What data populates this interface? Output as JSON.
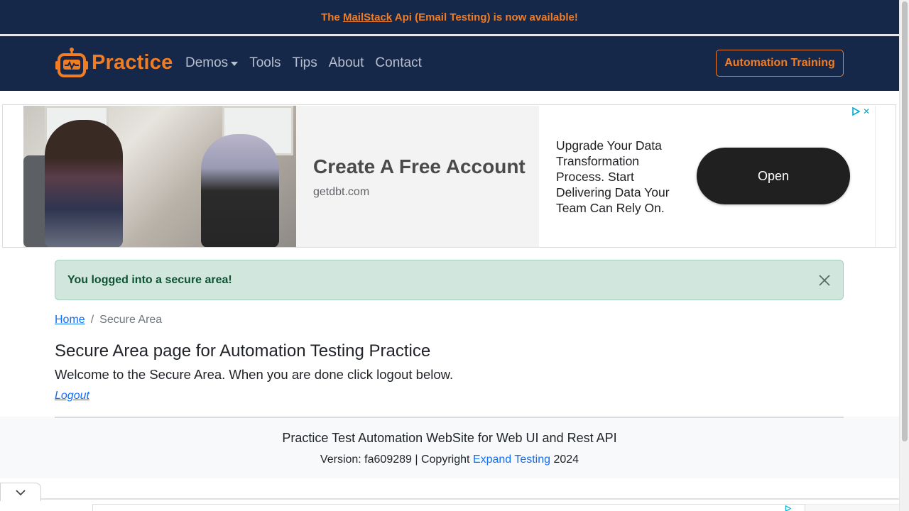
{
  "announcement": {
    "prefix": "The ",
    "link": "MailStack",
    "suffix": " Api (Email Testing) is now available!"
  },
  "nav": {
    "brand": "Practice",
    "links": [
      "Demos",
      "Tools",
      "Tips",
      "About",
      "Contact"
    ],
    "cta": "Automation Training"
  },
  "ad": {
    "headline": "Create A Free Account",
    "domain": "getdbt.com",
    "body": "Upgrade Your Data Transformation Process. Start Delivering Data Your Team Can Rely On.",
    "button": "Open",
    "choices_icon": "adchoices-icon",
    "close_label": "✕"
  },
  "alert": {
    "message": "You logged into a secure area!"
  },
  "breadcrumb": {
    "home": "Home",
    "separator": "/",
    "current": "Secure Area"
  },
  "main": {
    "title": "Secure Area page for Automation Testing Practice",
    "subtitle": "Welcome to the Secure Area. When you are done click logout below.",
    "logout": "Logout"
  },
  "footer": {
    "title": "Practice Test Automation WebSite for Web UI and Rest API",
    "version_prefix": "Version: fa609289 | Copyright ",
    "company": "Expand Testing",
    "year": " 2024"
  },
  "colors": {
    "navy": "#16284a",
    "orange": "#f07c24",
    "link": "#0d6efd",
    "success_bg": "#d1e7dd",
    "success_text": "#0f5132"
  }
}
